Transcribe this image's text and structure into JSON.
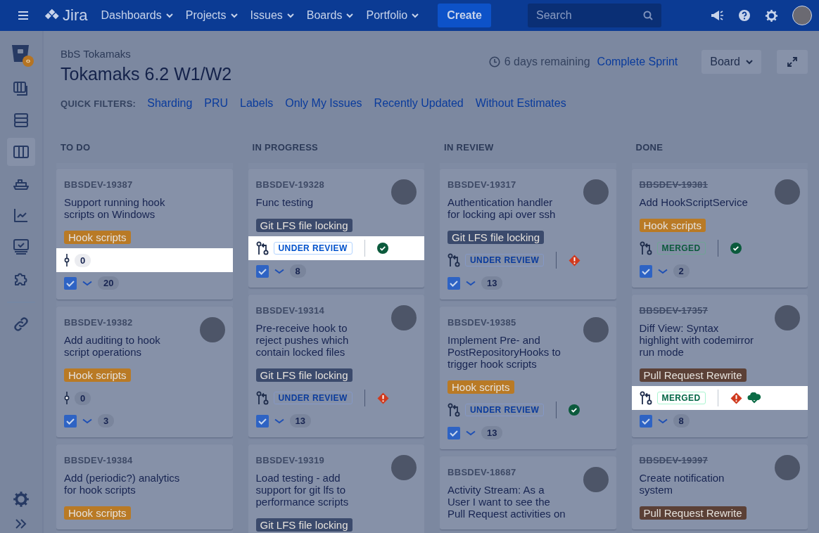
{
  "nav": {
    "logo": "Jira",
    "menus": [
      {
        "label": "Dashboards"
      },
      {
        "label": "Projects"
      },
      {
        "label": "Issues"
      },
      {
        "label": "Boards"
      },
      {
        "label": "Portfolio"
      }
    ],
    "create": "Create",
    "search": {
      "placeholder": "Search"
    }
  },
  "sidebar": {
    "items": [
      {
        "kind": "board-stack",
        "selected": false
      },
      {
        "kind": "backlog",
        "selected": false
      },
      {
        "kind": "board",
        "selected": true
      },
      {
        "kind": "ship",
        "selected": false
      },
      {
        "kind": "chart",
        "selected": false
      },
      {
        "kind": "monitor",
        "selected": false
      },
      {
        "kind": "puzzle",
        "selected": false
      }
    ],
    "links": [
      {
        "kind": "link"
      }
    ]
  },
  "header": {
    "breadcrumb": "BbS Tokamaks",
    "title": "Tokamaks 6.2 W1/W2",
    "remaining": "6 days remaining",
    "complete": "Complete Sprint",
    "board_button": "Board"
  },
  "quick_filters": {
    "label": "QUICK FILTERS:",
    "items": [
      "Sharding",
      "PRU",
      "Labels",
      "Only My Issues",
      "Recently Updated",
      "Without Estimates"
    ]
  },
  "columns": [
    {
      "title": "TO DO",
      "cards": [
        {
          "key": "BBSDEV-19387",
          "done": false,
          "summary": "Support running hook scripts on Windows",
          "avatar": false,
          "epic": {
            "text": "Hook scripts",
            "color": "#b97a25"
          },
          "dev": {
            "kind": "commits",
            "count": "0",
            "highlighted": true
          },
          "estimate": "20"
        },
        {
          "key": "BBSDEV-19382",
          "done": false,
          "summary": "Add auditing to hook script operations",
          "avatar": true,
          "epic": {
            "text": "Hook scripts",
            "color": "#b97a25"
          },
          "dev": {
            "kind": "commits",
            "count": "0",
            "highlighted": false
          },
          "estimate": "3"
        },
        {
          "key": "BBSDEV-19384",
          "done": false,
          "summary": "Add (periodic?) analytics for hook scripts",
          "avatar": false,
          "epic": {
            "text": "Hook scripts",
            "color": "#b97a25"
          }
        }
      ]
    },
    {
      "title": "IN PROGRESS",
      "cards": [
        {
          "key": "BBSDEV-19328",
          "done": false,
          "summary": "Func testing",
          "avatar": true,
          "epic": {
            "text": "Git LFS file locking",
            "color": "#3b4a6c"
          },
          "dev": {
            "kind": "pr",
            "status": {
              "text": "UNDER REVIEW",
              "kind": "review"
            },
            "builds": [
              {
                "kind": "success"
              }
            ],
            "highlighted": true
          },
          "estimate": "8"
        },
        {
          "key": "BBSDEV-19314",
          "done": false,
          "summary": "Pre-receive hook to reject pushes which contain locked files",
          "avatar": true,
          "epic": {
            "text": "Git LFS file locking",
            "color": "#3b4a6c"
          },
          "dev": {
            "kind": "pr",
            "status": {
              "text": "UNDER REVIEW",
              "kind": "review"
            },
            "builds": [
              {
                "kind": "failed"
              }
            ],
            "highlighted": false
          },
          "estimate": "13"
        },
        {
          "key": "BBSDEV-19319",
          "done": false,
          "summary": "Load testing - add support for git lfs to performance scripts",
          "avatar": true,
          "epic": {
            "text": "Git LFS file locking",
            "color": "#3b4a6c"
          }
        }
      ]
    },
    {
      "title": "IN REVIEW",
      "cards": [
        {
          "key": "BBSDEV-19317",
          "done": false,
          "summary": "Authentication handler for locking api over ssh",
          "avatar": true,
          "epic": {
            "text": "Git LFS file locking",
            "color": "#3b4a6c"
          },
          "dev": {
            "kind": "pr",
            "status": {
              "text": "UNDER REVIEW",
              "kind": "review"
            },
            "builds": [
              {
                "kind": "failed"
              }
            ],
            "highlighted": false
          },
          "estimate": "13"
        },
        {
          "key": "BBSDEV-19385",
          "done": false,
          "summary": "Implement Pre- and PostRepositoryHooks to trigger hook scripts",
          "avatar": true,
          "epic": {
            "text": "Hook scripts",
            "color": "#b97a25"
          },
          "dev": {
            "kind": "pr",
            "status": {
              "text": "UNDER REVIEW",
              "kind": "review"
            },
            "builds": [
              {
                "kind": "success"
              }
            ],
            "highlighted": false
          },
          "estimate": "13"
        },
        {
          "key": "BBSDEV-18687",
          "done": false,
          "summary": "Activity Stream: As a User I want to see the Pull Request activities on",
          "avatar": true
        }
      ]
    },
    {
      "title": "DONE",
      "cards": [
        {
          "key": "BBSDEV-19381",
          "done": true,
          "summary": "Add HookScriptService",
          "avatar": true,
          "epic": {
            "text": "Hook scripts",
            "color": "#b97a25"
          },
          "dev": {
            "kind": "pr",
            "status": {
              "text": "MERGED",
              "kind": "merged"
            },
            "builds": [
              {
                "kind": "success"
              }
            ],
            "highlighted": false
          },
          "estimate": "2"
        },
        {
          "key": "BBSDEV-17357",
          "done": true,
          "summary": "Diff View: Syntax highlight with codemirror run mode",
          "avatar": true,
          "epic": {
            "text": "Pull Request Rewrite",
            "color": "#5b4036"
          },
          "dev": {
            "kind": "pr",
            "status": {
              "text": "MERGED",
              "kind": "merged"
            },
            "builds": [
              {
                "kind": "failed"
              },
              {
                "kind": "deployed"
              }
            ],
            "highlighted": true
          },
          "estimate": "8"
        },
        {
          "key": "BBSDEV-19397",
          "done": true,
          "summary": "Create notification system",
          "avatar": true,
          "epic": {
            "text": "Pull Request Rewrite",
            "color": "#5b4036"
          }
        }
      ]
    }
  ]
}
